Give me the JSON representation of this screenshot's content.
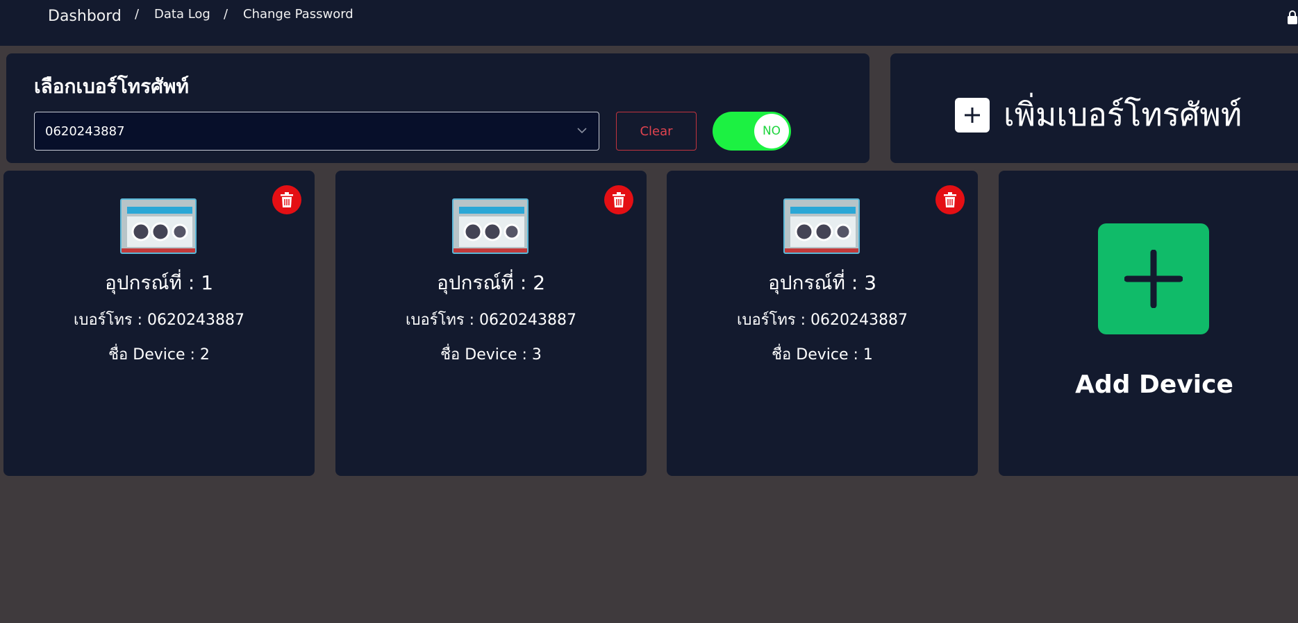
{
  "nav": {
    "brand": "Dashbord",
    "separator": "/",
    "data_log": "Data Log",
    "change_password": "Change Password"
  },
  "phone_panel": {
    "title": "เลือกเบอร์โทรศัพท์",
    "selected_phone": "0620243887",
    "clear_label": "Clear",
    "toggle_label": "NO"
  },
  "add_phone": {
    "label": "เพิ่มเบอร์โทรศัพท์"
  },
  "devices": [
    {
      "title": "อุปกรณ์ที่ : 1",
      "phone": "เบอร์โทร : 0620243887",
      "name": "ชื่อ Device : 2"
    },
    {
      "title": "อุปกรณ์ที่ : 2",
      "phone": "เบอร์โทร : 0620243887",
      "name": "ชื่อ Device : 3"
    },
    {
      "title": "อุปกรณ์ที่ : 3",
      "phone": "เบอร์โทร : 0620243887",
      "name": "ชื่อ Device : 1"
    }
  ],
  "add_device": {
    "label": "Add Device"
  },
  "colors": {
    "background": "#3f3a3d",
    "panel": "#131a2e",
    "toggle_on": "#1cf142",
    "delete": "#e40f14",
    "add_device": "#10bb69",
    "clear": "#e0434f"
  },
  "icons": {
    "lock": "lock-icon",
    "chevron": "chevron-down-icon",
    "plus": "plus-icon",
    "trash": "trash-icon"
  }
}
